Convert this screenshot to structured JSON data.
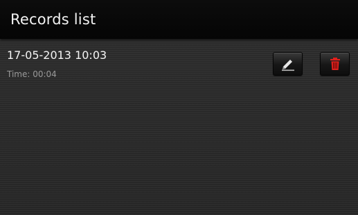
{
  "app": {
    "title": "Records list"
  },
  "records": [
    {
      "datetime": "17-05-2013 10:03",
      "duration_text": "Time: 00:04",
      "actions": {
        "edit_icon": "pencil-icon",
        "delete_icon": "trash-icon"
      }
    }
  ],
  "colors": {
    "titlebar_bg": "#080808",
    "content_bg": "#2a2a2a",
    "delete_accent": "#e0201c",
    "text_primary": "#f5f5f5",
    "text_secondary": "#9a9a9a"
  }
}
